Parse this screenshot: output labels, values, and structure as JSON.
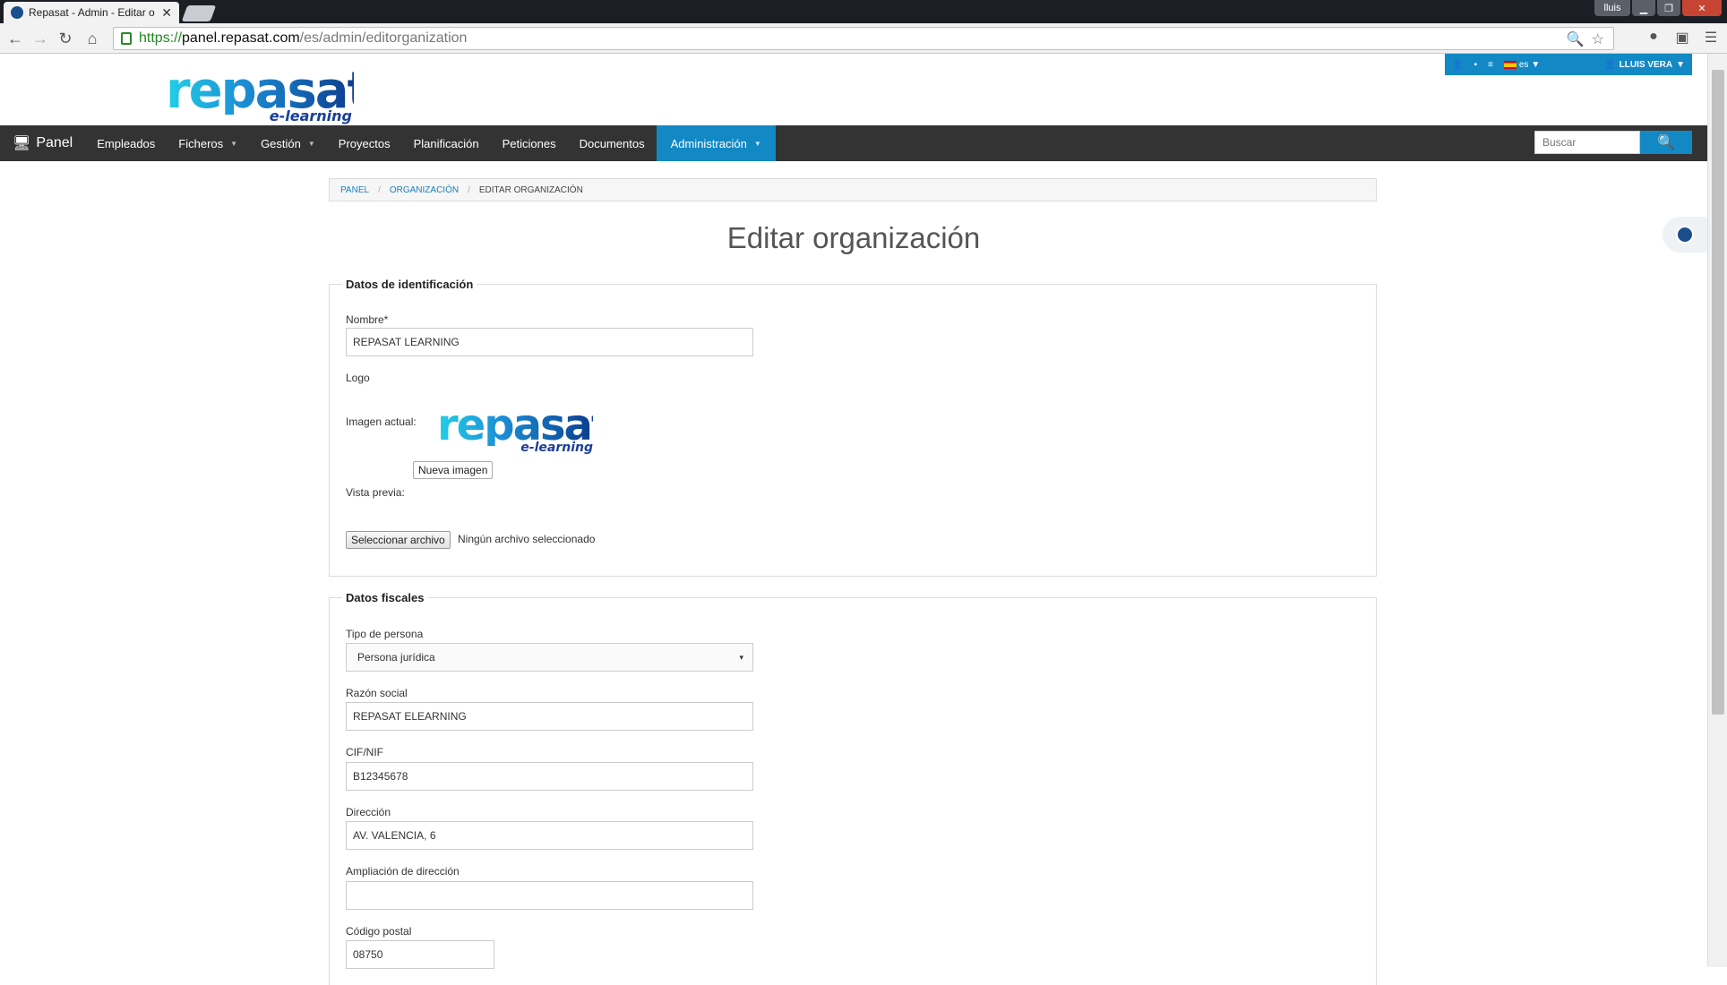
{
  "browser": {
    "tab_title": "Repasat - Admin - Editar o",
    "url_scheme": "https://",
    "url_host": "panel.repasat.com",
    "url_path": "/es/admin/editorganization",
    "window_user": "lluis"
  },
  "header": {
    "logo_main": "repasat",
    "logo_sub": "e-learning",
    "lang": "es",
    "user_name": "LLUIS VERA"
  },
  "nav": {
    "brand": "Panel",
    "items": [
      {
        "label": "Empleados",
        "dropdown": false
      },
      {
        "label": "Ficheros",
        "dropdown": true
      },
      {
        "label": "Gestión",
        "dropdown": true
      },
      {
        "label": "Proyectos",
        "dropdown": false
      },
      {
        "label": "Planificación",
        "dropdown": false
      },
      {
        "label": "Peticiones",
        "dropdown": false
      },
      {
        "label": "Documentos",
        "dropdown": false
      },
      {
        "label": "Administración",
        "dropdown": true,
        "active": true
      }
    ],
    "search_placeholder": "Buscar"
  },
  "breadcrumb": {
    "items": [
      "PANEL",
      "ORGANIZACIÓN"
    ],
    "current": "EDITAR ORGANIZACIÓN"
  },
  "page_title": "Editar organización",
  "identification": {
    "legend": "Datos de identificación",
    "nombre_label": "Nombre*",
    "nombre_value": "REPASAT LEARNING",
    "logo_label": "Logo",
    "imagen_actual_label": "Imagen actual:",
    "nueva_imagen_label": "Nueva imagen",
    "vista_previa_label": "Vista previa:",
    "file_button": "Seleccionar archivo",
    "file_status": "Ningún archivo seleccionado"
  },
  "fiscal": {
    "legend": "Datos fiscales",
    "tipo_label": "Tipo de persona",
    "tipo_value": "Persona jurídica",
    "razon_label": "Razón social",
    "razon_value": "REPASAT ELEARNING",
    "cif_label": "CIF/NIF",
    "cif_value": "B12345678",
    "direccion_label": "Dirección",
    "direccion_value": "AV. VALENCIA, 6",
    "ampliacion_label": "Ampliación de dirección",
    "ampliacion_value": "",
    "cp_label": "Código postal",
    "cp_value": "08750"
  },
  "colors": {
    "accent": "#1289c4",
    "navbar": "#333333"
  }
}
